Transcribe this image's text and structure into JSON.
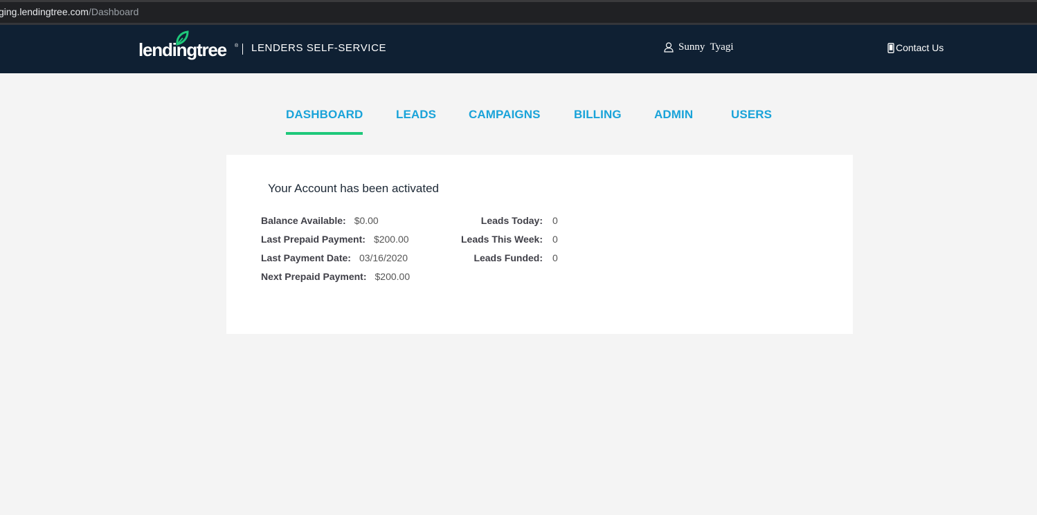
{
  "browser": {
    "url_host": "ging.lendingtree.com",
    "url_path": "/Dashboard"
  },
  "header": {
    "logo_text": "lendingtree",
    "logo_reg": "®",
    "product_name": "LENDERS SELF-SERVICE",
    "user_name": "Sunny  Tyagi",
    "contact_label": "Contact Us"
  },
  "nav": {
    "tabs": [
      {
        "label": "DASHBOARD",
        "active": true
      },
      {
        "label": "LEADS",
        "active": false
      },
      {
        "label": "CAMPAIGNS",
        "active": false
      },
      {
        "label": "BILLING",
        "active": false
      },
      {
        "label": "ADMIN",
        "active": false
      },
      {
        "label": "USERS",
        "active": false
      }
    ]
  },
  "account": {
    "title": "Your Account has been activated",
    "left_stats": [
      {
        "label": "Balance Available:",
        "value": "$0.00"
      },
      {
        "label": "Last Prepaid Payment:",
        "value": "$200.00"
      },
      {
        "label": "Last Payment Date:",
        "value": "03/16/2020"
      },
      {
        "label": "Next Prepaid Payment:",
        "value": "$200.00"
      }
    ],
    "right_stats": [
      {
        "label": "Leads Today:",
        "value": "0"
      },
      {
        "label": "Leads This Week:",
        "value": "0"
      },
      {
        "label": "Leads Funded:",
        "value": "0"
      }
    ]
  },
  "colors": {
    "header_bg": "#0f2033",
    "nav_link": "#1aa3d9",
    "active_underline": "#1ec87a",
    "leaf_green": "#1ec87a"
  },
  "icons": {
    "user": "user-icon",
    "phone": "phone-icon",
    "logo_leaf": "leaf-icon"
  }
}
